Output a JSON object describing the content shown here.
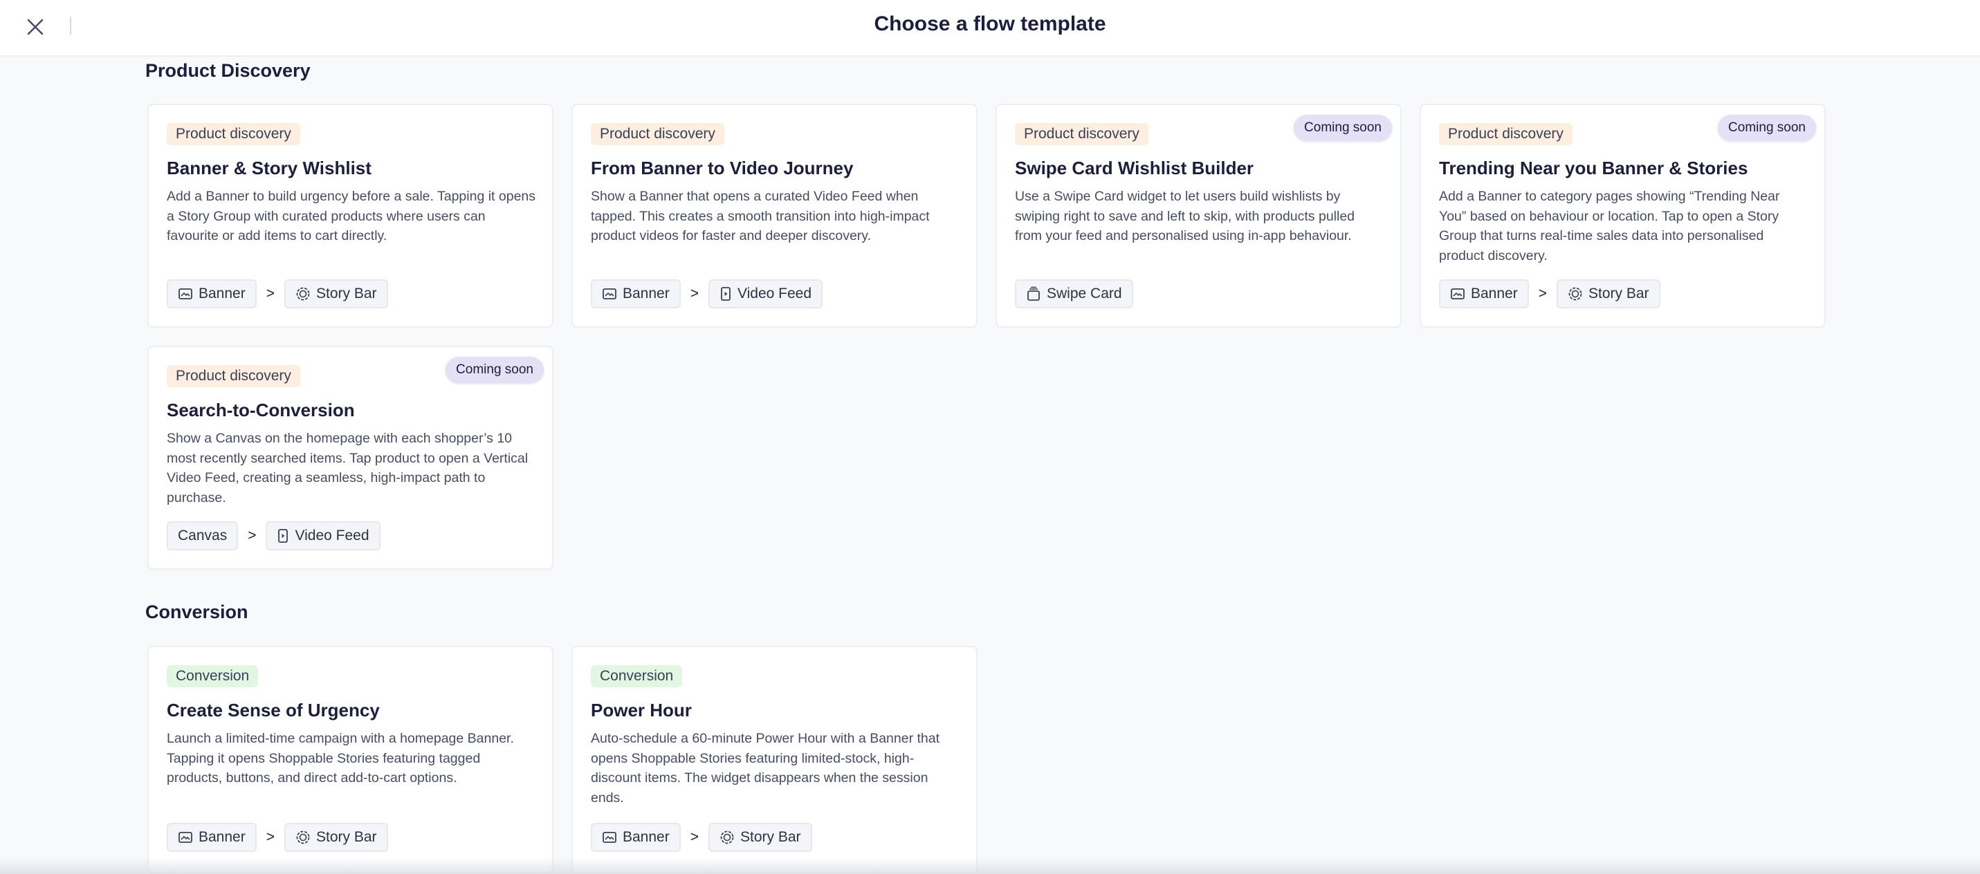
{
  "header": {
    "title": "Choose a flow template",
    "close_icon": "close-icon"
  },
  "sections": [
    {
      "title": "Product Discovery",
      "cards": [
        {
          "tag": "Product discovery",
          "coming_soon": "",
          "title": "Banner & Story Wishlist",
          "description": "Add a Banner to build urgency before a sale. Tapping it opens a Story Group with curated products where users can favourite or add items to cart directly.",
          "chips": [
            {
              "label": "Banner",
              "icon": "banner-icon"
            },
            {
              "label": "Story Bar",
              "icon": "story-bar-icon"
            }
          ],
          "separator": ">"
        },
        {
          "tag": "Product discovery",
          "coming_soon": "",
          "title": "From Banner to Video Journey",
          "description": "Show a Banner that opens a curated Video Feed when tapped. This creates a smooth transition into high-impact product videos for faster and deeper discovery.",
          "chips": [
            {
              "label": "Banner",
              "icon": "banner-icon"
            },
            {
              "label": "Video Feed",
              "icon": "video-feed-icon"
            }
          ],
          "separator": ">"
        },
        {
          "tag": "Product discovery",
          "coming_soon": "Coming soon",
          "title": "Swipe Card Wishlist Builder",
          "description": "Use a Swipe Card widget to let users build wishlists by swiping right to save and left to skip, with products pulled from your feed and personalised using in-app behaviour.",
          "chips": [
            {
              "label": "Swipe Card",
              "icon": "swipe-card-icon"
            }
          ],
          "separator": ""
        },
        {
          "tag": "Product discovery",
          "coming_soon": "Coming soon",
          "title": "Trending Near you Banner & Stories",
          "description": "Add a Banner to category pages showing “Trending Near You” based on behaviour or location. Tap to open a Story Group that turns real-time sales data into personalised product discovery.",
          "chips": [
            {
              "label": "Banner",
              "icon": "banner-icon"
            },
            {
              "label": "Story Bar",
              "icon": "story-bar-icon"
            }
          ],
          "separator": ">"
        },
        {
          "tag": "Product discovery",
          "coming_soon": "Coming soon",
          "title": "Search-to-Conversion",
          "description": "Show a Canvas on the homepage with each shopper’s 10 most recently searched items. Tap product to open a Vertical Video Feed, creating a seamless, high-impact path to purchase.",
          "chips": [
            {
              "label": "Canvas",
              "icon": ""
            },
            {
              "label": "Video Feed",
              "icon": "video-feed-icon"
            }
          ],
          "separator": ">"
        }
      ]
    },
    {
      "title": "Conversion",
      "cards": [
        {
          "tag": "Conversion",
          "coming_soon": "",
          "title": "Create Sense of Urgency",
          "description": "Launch a limited-time campaign with a homepage Banner. Tapping it opens Shoppable Stories featuring tagged products, buttons, and direct add-to-cart options.",
          "chips": [
            {
              "label": "Banner",
              "icon": "banner-icon"
            },
            {
              "label": "Story Bar",
              "icon": "story-bar-icon"
            }
          ],
          "separator": ">"
        },
        {
          "tag": "Conversion",
          "coming_soon": "",
          "title": "Power Hour",
          "description": "Auto-schedule a 60-minute Power Hour with a Banner that opens Shoppable Stories featuring limited-stock, high-discount items. The widget disappears when the session ends.",
          "chips": [
            {
              "label": "Banner",
              "icon": "banner-icon"
            },
            {
              "label": "Story Bar",
              "icon": "story-bar-icon"
            }
          ],
          "separator": ">"
        }
      ]
    }
  ]
}
